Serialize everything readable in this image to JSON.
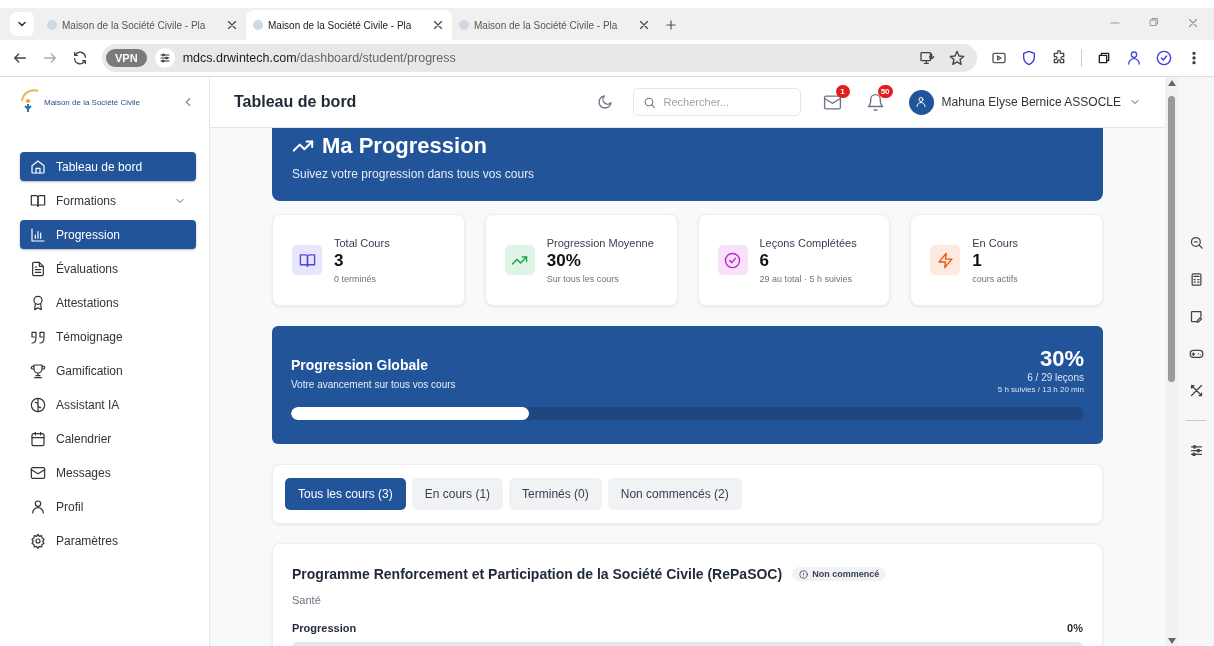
{
  "browser": {
    "tabs": [
      {
        "title": "Maison de la Société Civile - Pla",
        "selected": false
      },
      {
        "title": "Maison de la Société Civile - Pla",
        "selected": true
      },
      {
        "title": "Maison de la Société Civile - Pla",
        "selected": false
      }
    ],
    "vpn_label": "VPN",
    "url_host": "mdcs.drwintech.com",
    "url_path": "/dashboard/student/progress"
  },
  "sidebar": {
    "logo_text": "Maison de la Société Civile",
    "items": [
      {
        "label": "Tableau de bord",
        "selected": true,
        "has_submenu": false
      },
      {
        "label": "Formations",
        "selected": false,
        "has_submenu": true
      },
      {
        "label": "Progression",
        "selected": true,
        "has_submenu": false
      },
      {
        "label": "Évaluations",
        "selected": false,
        "has_submenu": false
      },
      {
        "label": "Attestations",
        "selected": false,
        "has_submenu": false
      },
      {
        "label": "Témoignage",
        "selected": false,
        "has_submenu": false
      },
      {
        "label": "Gamification",
        "selected": false,
        "has_submenu": false
      },
      {
        "label": "Assistant IA",
        "selected": false,
        "has_submenu": false
      },
      {
        "label": "Calendrier",
        "selected": false,
        "has_submenu": false
      },
      {
        "label": "Messages",
        "selected": false,
        "has_submenu": false
      },
      {
        "label": "Profil",
        "selected": false,
        "has_submenu": false
      },
      {
        "label": "Paramètres",
        "selected": false,
        "has_submenu": false
      }
    ]
  },
  "header": {
    "title": "Tableau de bord",
    "search_placeholder": "Rechercher...",
    "mail_badge": "1",
    "bell_badge": "50",
    "user_name": "Mahuna Elyse Bernice ASSOCLE"
  },
  "hero": {
    "title": "Ma Progression",
    "subtitle": "Suivez votre progression dans tous vos cours"
  },
  "stats": [
    {
      "label": "Total Cours",
      "value": "3",
      "note": "0 terminés",
      "color": "#4f46e5"
    },
    {
      "label": "Progression Moyenne",
      "value": "30%",
      "note": "Sur tous les cours",
      "color": "#16a34a"
    },
    {
      "label": "Leçons Complétées",
      "value": "6",
      "note": "29 au total · 5 h suivies",
      "color": "#c026d3"
    },
    {
      "label": "En Cours",
      "value": "1",
      "note": "cours actifs",
      "color": "#ea580c"
    }
  ],
  "global": {
    "title": "Progression Globale",
    "subtitle": "Votre avancement sur tous vos cours",
    "percent": "30%",
    "lessons": "6 / 29 leçons",
    "time": "5 h suivies / 13 h 20 min",
    "level": 0.3
  },
  "filters": [
    {
      "label": "Tous les cours (3)",
      "selected": true
    },
    {
      "label": "En cours (1)",
      "selected": false
    },
    {
      "label": "Terminés (0)",
      "selected": false
    },
    {
      "label": "Non commencés (2)",
      "selected": false
    }
  ],
  "courses": [
    {
      "title": "Programme Renforcement et Participation de la Société Civile (RePaSOC)",
      "status": "Non commencé",
      "category": "Santé",
      "progress_label": "Progression",
      "percent": "0%",
      "level": 0
    }
  ]
}
